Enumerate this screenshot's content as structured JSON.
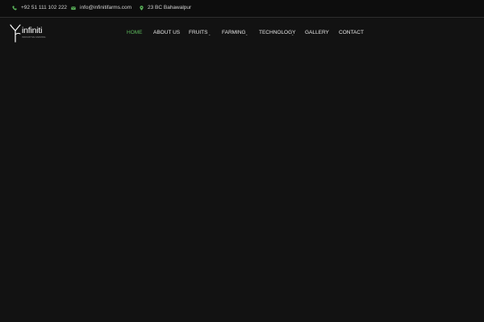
{
  "topbar": {
    "phone": "+92 51 111 102 222",
    "email": "info@infinitifarms.com",
    "address": "23 BC Bahawalpur",
    "icon_color": "#5cb85c",
    "icons": {
      "phone": "phone-icon",
      "email": "envelope-icon",
      "address": "map-pin-icon"
    }
  },
  "logo": {
    "name": "infiniti",
    "tagline": "INNOVATIVE FARMING"
  },
  "nav": {
    "active_color": "#5cb85c",
    "items": [
      {
        "label": "HOME",
        "active": true,
        "has_dropdown": false
      },
      {
        "label": "ABOUT US",
        "active": false,
        "has_dropdown": false
      },
      {
        "label": "FRUITS",
        "active": false,
        "has_dropdown": true
      },
      {
        "label": "FARMING",
        "active": false,
        "has_dropdown": true
      },
      {
        "label": "TECHNOLOGY",
        "active": false,
        "has_dropdown": true
      },
      {
        "label": "GALLERY",
        "active": false,
        "has_dropdown": false
      },
      {
        "label": "CONTACT",
        "active": false,
        "has_dropdown": false
      }
    ],
    "dropdown_icon": "chevron-down-icon"
  },
  "colors": {
    "background": "#121212",
    "topbar_background": "#0d0d0d",
    "text": "#e8e8e8"
  }
}
